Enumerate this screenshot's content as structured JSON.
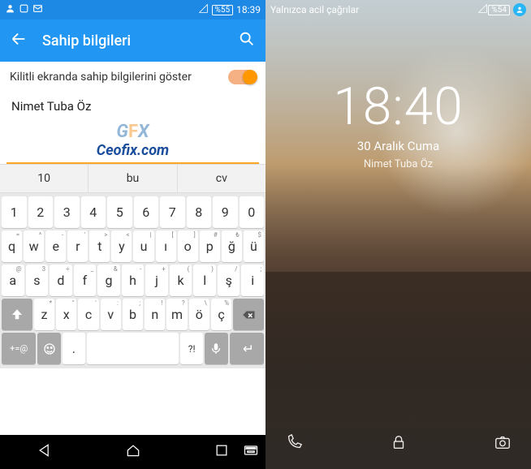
{
  "left": {
    "status": {
      "battery": "%55",
      "time": "18:39"
    },
    "appbar": {
      "title": "Sahip bilgileri"
    },
    "toggle": {
      "label": "Kilitli ekranda sahip bilgilerini göster"
    },
    "input": {
      "value": "Nimet Tuba Öz"
    },
    "watermark": {
      "gfx_prefix": "G",
      "gfx_mid": "F",
      "gfx_suffix": "X",
      "site": "Ceofix.com"
    },
    "suggestions": [
      "10",
      "bu",
      "cv"
    ],
    "keyboard": {
      "row1": [
        "1",
        "2",
        "3",
        "4",
        "5",
        "6",
        "7",
        "8",
        "9",
        "0"
      ],
      "row2": [
        {
          "m": "q",
          "s": "="
        },
        {
          "m": "w",
          "s": "^"
        },
        {
          "m": "e",
          "s": "-"
        },
        {
          "m": "r",
          "s": "'"
        },
        {
          "m": "t",
          "s": ">"
        },
        {
          "m": "y",
          "s": "<"
        },
        {
          "m": "u",
          "s": "|"
        },
        {
          "m": "ı",
          "s": "["
        },
        {
          "m": "o",
          "s": "]"
        },
        {
          "m": "p",
          "s": "#"
        },
        {
          "m": "ğ",
          "s": "₺"
        },
        {
          "m": "ü",
          "s": "$"
        }
      ],
      "row3": [
        {
          "m": "a",
          "s": "@"
        },
        {
          "m": "s",
          "s": "3"
        },
        {
          "m": "d",
          "s": "÷"
        },
        {
          "m": "f",
          "s": "_"
        },
        {
          "m": "g",
          "s": "&"
        },
        {
          "m": "h",
          "s": "-"
        },
        {
          "m": "j",
          "s": "+"
        },
        {
          "m": "k",
          "s": "("
        },
        {
          "m": "l",
          "s": ")"
        },
        {
          "m": "ş",
          "s": "/"
        },
        {
          "m": "i",
          "s": ";"
        }
      ],
      "row4": [
        {
          "m": "z",
          "s": "*"
        },
        {
          "m": "x",
          "s": "\""
        },
        {
          "m": "c",
          "s": "'"
        },
        {
          "m": "v",
          "s": ":"
        },
        {
          "m": "b",
          "s": ";"
        },
        {
          "m": "n",
          "s": "!"
        },
        {
          "m": "m",
          "s": "?"
        },
        {
          "m": "ö",
          "s": "\\"
        },
        {
          "m": "ç",
          "s": "%"
        }
      ],
      "symkey": "+=@",
      "period": ".",
      "question": "?!"
    }
  },
  "right": {
    "status": {
      "text": "Yalnızca acil çağrılar",
      "battery": "%54"
    },
    "lock": {
      "time": "18:40",
      "date": "30 Aralık Cuma",
      "owner": "Nimet Tuba Öz"
    }
  }
}
